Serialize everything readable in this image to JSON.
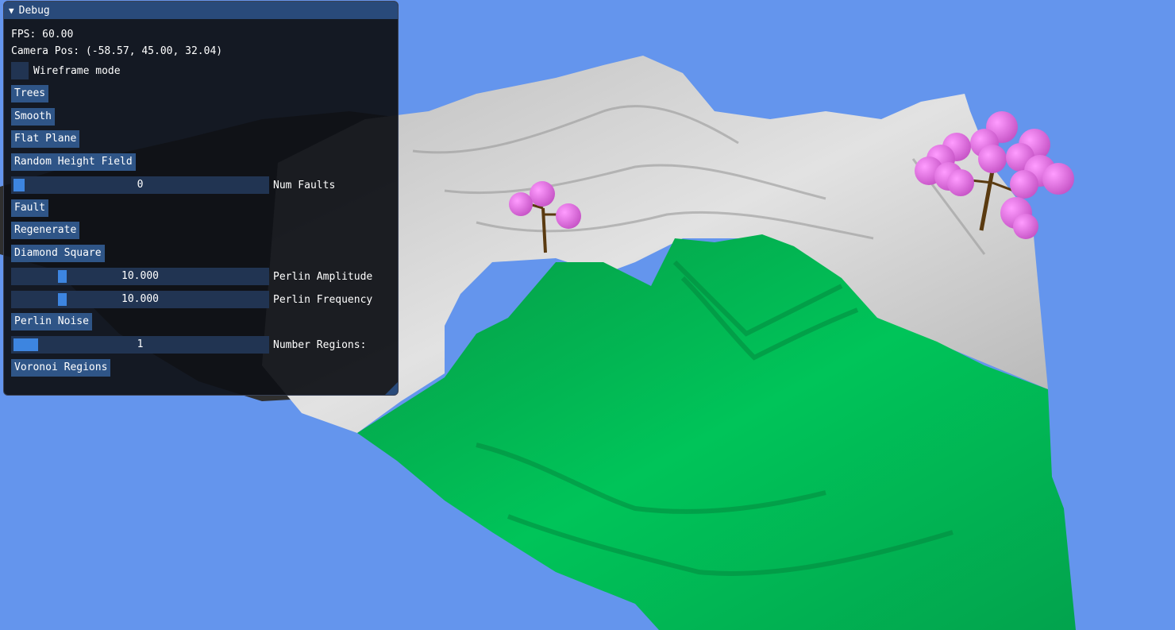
{
  "window": {
    "title": "Debug",
    "fps_text": "FPS: 60.00",
    "camera_text": "Camera Pos: (-58.57, 45.00, 32.04)",
    "wireframe": {
      "label": "Wireframe mode",
      "checked": false
    },
    "buttons": {
      "trees": "Trees",
      "smooth": "Smooth",
      "flat_plane": "Flat Plane",
      "random_height_field": "Random Height Field",
      "fault": "Fault",
      "regenerate": "Regenerate",
      "diamond_square": "Diamond Square",
      "perlin_noise": "Perlin Noise",
      "voronoi_regions": "Voronoi Regions"
    },
    "sliders": {
      "num_faults": {
        "value": "0",
        "label": "Num Faults"
      },
      "perlin_amplitude": {
        "value": "10.000",
        "label": "Perlin Amplitude"
      },
      "perlin_frequency": {
        "value": "10.000",
        "label": "Perlin Frequency"
      },
      "number_regions": {
        "value": "1",
        "label": "Number Regions:"
      }
    }
  },
  "colors": {
    "sky": "#6495ed",
    "snow": "#d8d8d8",
    "grass": "#00b050",
    "blossom": "#ee82ee",
    "trunk": "#5a3a10"
  }
}
